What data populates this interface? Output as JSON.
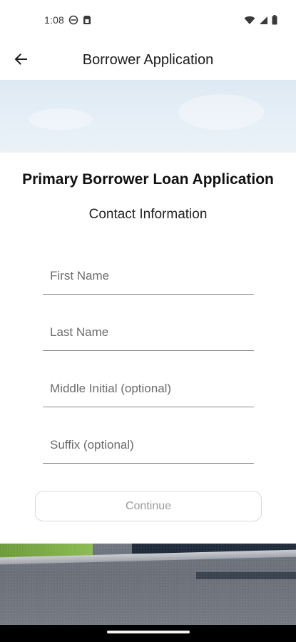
{
  "status_bar": {
    "time": "1:08",
    "icons": [
      "do-not-disturb-icon",
      "sim-card-icon",
      "wifi-icon",
      "cell-signal-icon",
      "battery-icon"
    ]
  },
  "app_bar": {
    "title": "Borrower Application",
    "back_icon": "arrow-back-icon"
  },
  "form": {
    "title": "Primary Borrower Loan Application",
    "subtitle": "Contact Information",
    "fields": [
      {
        "placeholder": "First Name",
        "value": ""
      },
      {
        "placeholder": "Last Name",
        "value": ""
      },
      {
        "placeholder": "Middle Initial (optional)",
        "value": ""
      },
      {
        "placeholder": "Suffix (optional)",
        "value": ""
      }
    ],
    "continue_label": "Continue"
  },
  "colors": {
    "sky": "#e3edf6",
    "button_border": "#d9d9d9",
    "button_text": "#9a9a9a",
    "field_underline": "#8a8a8a"
  }
}
